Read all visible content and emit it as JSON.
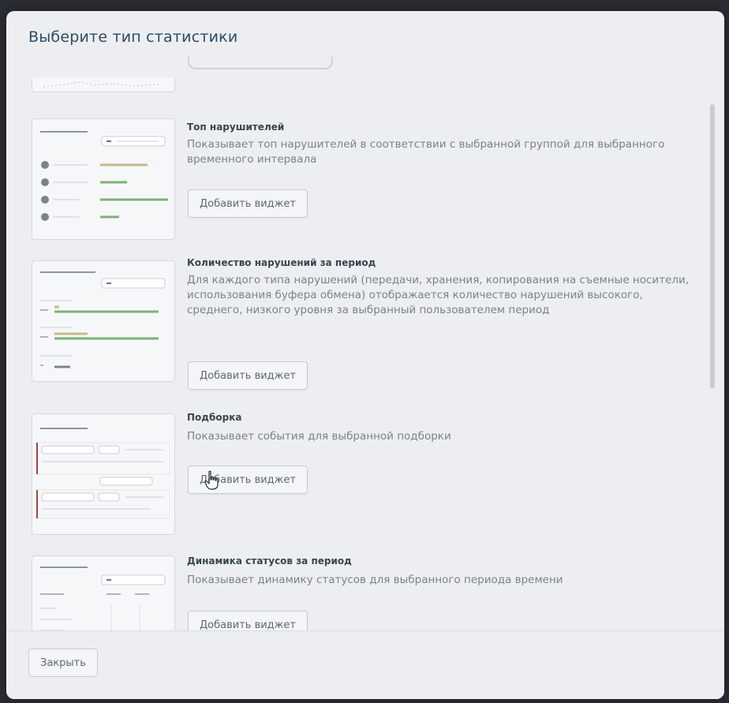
{
  "dialog": {
    "title": "Выберите тип статистики",
    "close_label": "Закрыть"
  },
  "items": [
    {
      "title": "Топ нарушителей",
      "description": "Показывает топ нарушителей в соответствии с выбранной группой для выбранного временного интервала",
      "button_label": "Добавить виджет"
    },
    {
      "title": "Количество нарушений за период",
      "description": "Для каждого типа нарушений (передачи, хранения, копирования на съемные носители, использования буфера обмена) отображается количество нарушений высокого, среднего, низкого уровня за выбранный пользователем период",
      "button_label": "Добавить виджет"
    },
    {
      "title": "Подборка",
      "description": "Показывает события для выбранной подборки",
      "button_label": "Добавить виджет"
    },
    {
      "title": "Динамика статусов за период",
      "description": "Показывает динамику статусов для выбранного периода времени",
      "button_label": "Добавить виджет"
    }
  ],
  "icons": {
    "cursor": "hand-pointer-icon"
  },
  "colors": {
    "title": "#2f4a66",
    "bar_green": "#7fb07a",
    "bar_tan": "#c9b88a"
  }
}
